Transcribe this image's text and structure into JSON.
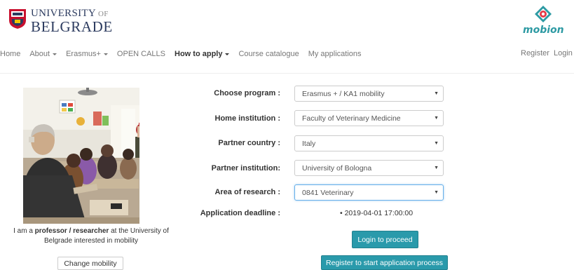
{
  "header": {
    "university_line1_big": "UNIVERSITY",
    "university_line1_small": " OF",
    "university_line2": "BELGRADE",
    "brand": "mobion"
  },
  "nav": {
    "items": [
      {
        "label": "Home",
        "dropdown": false
      },
      {
        "label": "About",
        "dropdown": true
      },
      {
        "label": "Erasmus+",
        "dropdown": true
      },
      {
        "label": "OPEN CALLS",
        "dropdown": false
      },
      {
        "label": "How to apply",
        "dropdown": true,
        "active": true
      },
      {
        "label": "Course catalogue",
        "dropdown": false
      },
      {
        "label": "My applications",
        "dropdown": false
      }
    ],
    "register": "Register",
    "login": "Login"
  },
  "profile": {
    "caption_prefix": "I am a ",
    "caption_role": "professor / researcher",
    "caption_suffix": " at the University of Belgrade interested in mobility",
    "change_button": "Change mobility"
  },
  "form": {
    "program_label": "Choose program :",
    "program_value": "Erasmus + / KA1 mobility",
    "home_label": "Home institution :",
    "home_value": "Faculty of Veterinary Medicine",
    "country_label": "Partner country :",
    "country_value": "Italy",
    "partner_label": "Partner institution:",
    "partner_value": "University of Bologna",
    "area_label": "Area of research :",
    "area_value": "0841 Veterinary",
    "deadline_label": "Application deadline :",
    "deadline_value": "2019-04-01 17:00:00"
  },
  "actions": {
    "login": "Login to proceed",
    "register": "Register to start application process"
  },
  "colors": {
    "accent": "#2a9aab",
    "university_blue": "#2c3b5f",
    "crest_red": "#c8102e"
  }
}
